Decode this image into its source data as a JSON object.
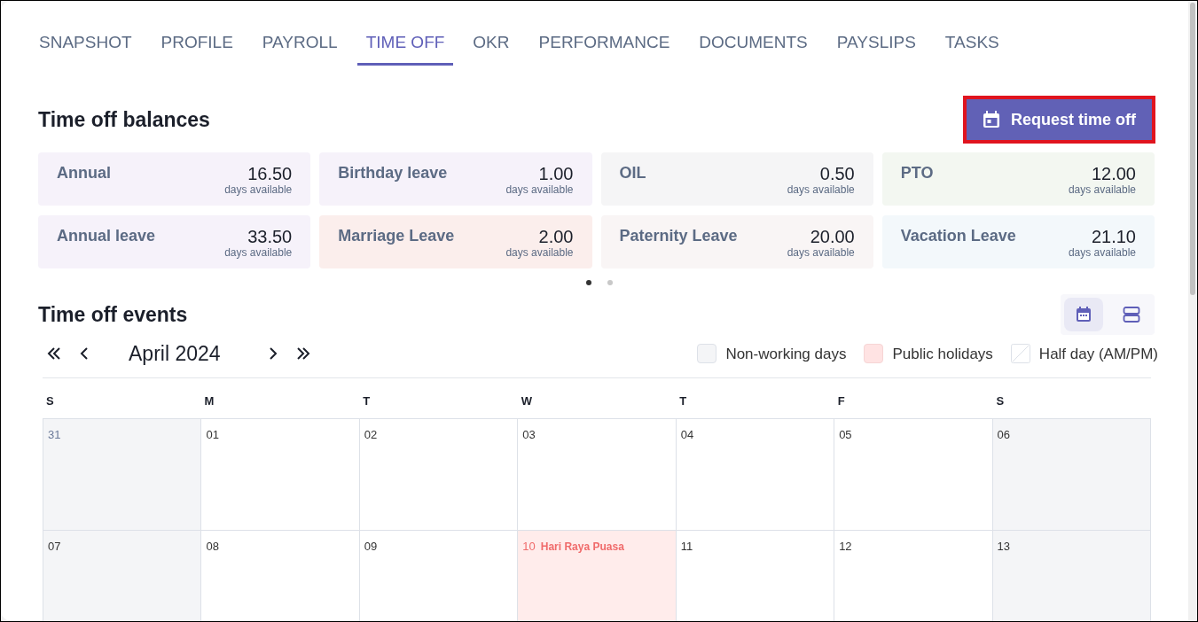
{
  "tabs": [
    {
      "label": "SNAPSHOT",
      "selected": false
    },
    {
      "label": "PROFILE",
      "selected": false
    },
    {
      "label": "PAYROLL",
      "selected": false
    },
    {
      "label": "TIME OFF",
      "selected": true
    },
    {
      "label": "OKR",
      "selected": false
    },
    {
      "label": "PERFORMANCE",
      "selected": false
    },
    {
      "label": "DOCUMENTS",
      "selected": false
    },
    {
      "label": "PAYSLIPS",
      "selected": false
    },
    {
      "label": "TASKS",
      "selected": false
    }
  ],
  "balances": {
    "title": "Time off balances",
    "request_button": "Request time off",
    "cards": [
      {
        "name": "Annual",
        "value": "16.50",
        "unit": "days available",
        "color": "#f6f2fa"
      },
      {
        "name": "Birthday leave",
        "value": "1.00",
        "unit": "days available",
        "color": "#f6f2fa"
      },
      {
        "name": "OIL",
        "value": "0.50",
        "unit": "days available",
        "color": "#f5f5f6"
      },
      {
        "name": "PTO",
        "value": "12.00",
        "unit": "days available",
        "color": "#f3f7f1"
      },
      {
        "name": "Annual leave",
        "value": "33.50",
        "unit": "days available",
        "color": "#f6f2fa"
      },
      {
        "name": "Marriage Leave",
        "value": "2.00",
        "unit": "days available",
        "color": "#fbeeec"
      },
      {
        "name": "Paternity Leave",
        "value": "20.00",
        "unit": "days available",
        "color": "#f9f5f5"
      },
      {
        "name": "Vacation Leave",
        "value": "21.10",
        "unit": "days available",
        "color": "#f3f8fb"
      }
    ],
    "pages": [
      {
        "selected": true
      },
      {
        "selected": false
      }
    ]
  },
  "events": {
    "title": "Time off events",
    "views": [
      {
        "kind": "calendar",
        "selected": true
      },
      {
        "kind": "list",
        "selected": false
      }
    ],
    "month": "April 2024",
    "legend": [
      {
        "kind": "non_working",
        "label": "Non-working days"
      },
      {
        "kind": "holiday",
        "label": "Public holidays"
      },
      {
        "kind": "half_day",
        "label": "Half day (AM/PM)"
      }
    ],
    "weekdays": [
      "S",
      "M",
      "T",
      "W",
      "T",
      "F",
      "S"
    ],
    "days": [
      {
        "day": "31",
        "kind": "other_month"
      },
      {
        "day": "01",
        "kind": "working"
      },
      {
        "day": "02",
        "kind": "working"
      },
      {
        "day": "03",
        "kind": "working"
      },
      {
        "day": "04",
        "kind": "working"
      },
      {
        "day": "05",
        "kind": "working"
      },
      {
        "day": "06",
        "kind": "non_working"
      },
      {
        "day": "07",
        "kind": "non_working"
      },
      {
        "day": "08",
        "kind": "working"
      },
      {
        "day": "09",
        "kind": "working"
      },
      {
        "day": "10",
        "kind": "holiday",
        "event": "Hari Raya Puasa"
      },
      {
        "day": "11",
        "kind": "working"
      },
      {
        "day": "12",
        "kind": "working"
      },
      {
        "day": "13",
        "kind": "non_working"
      }
    ]
  }
}
